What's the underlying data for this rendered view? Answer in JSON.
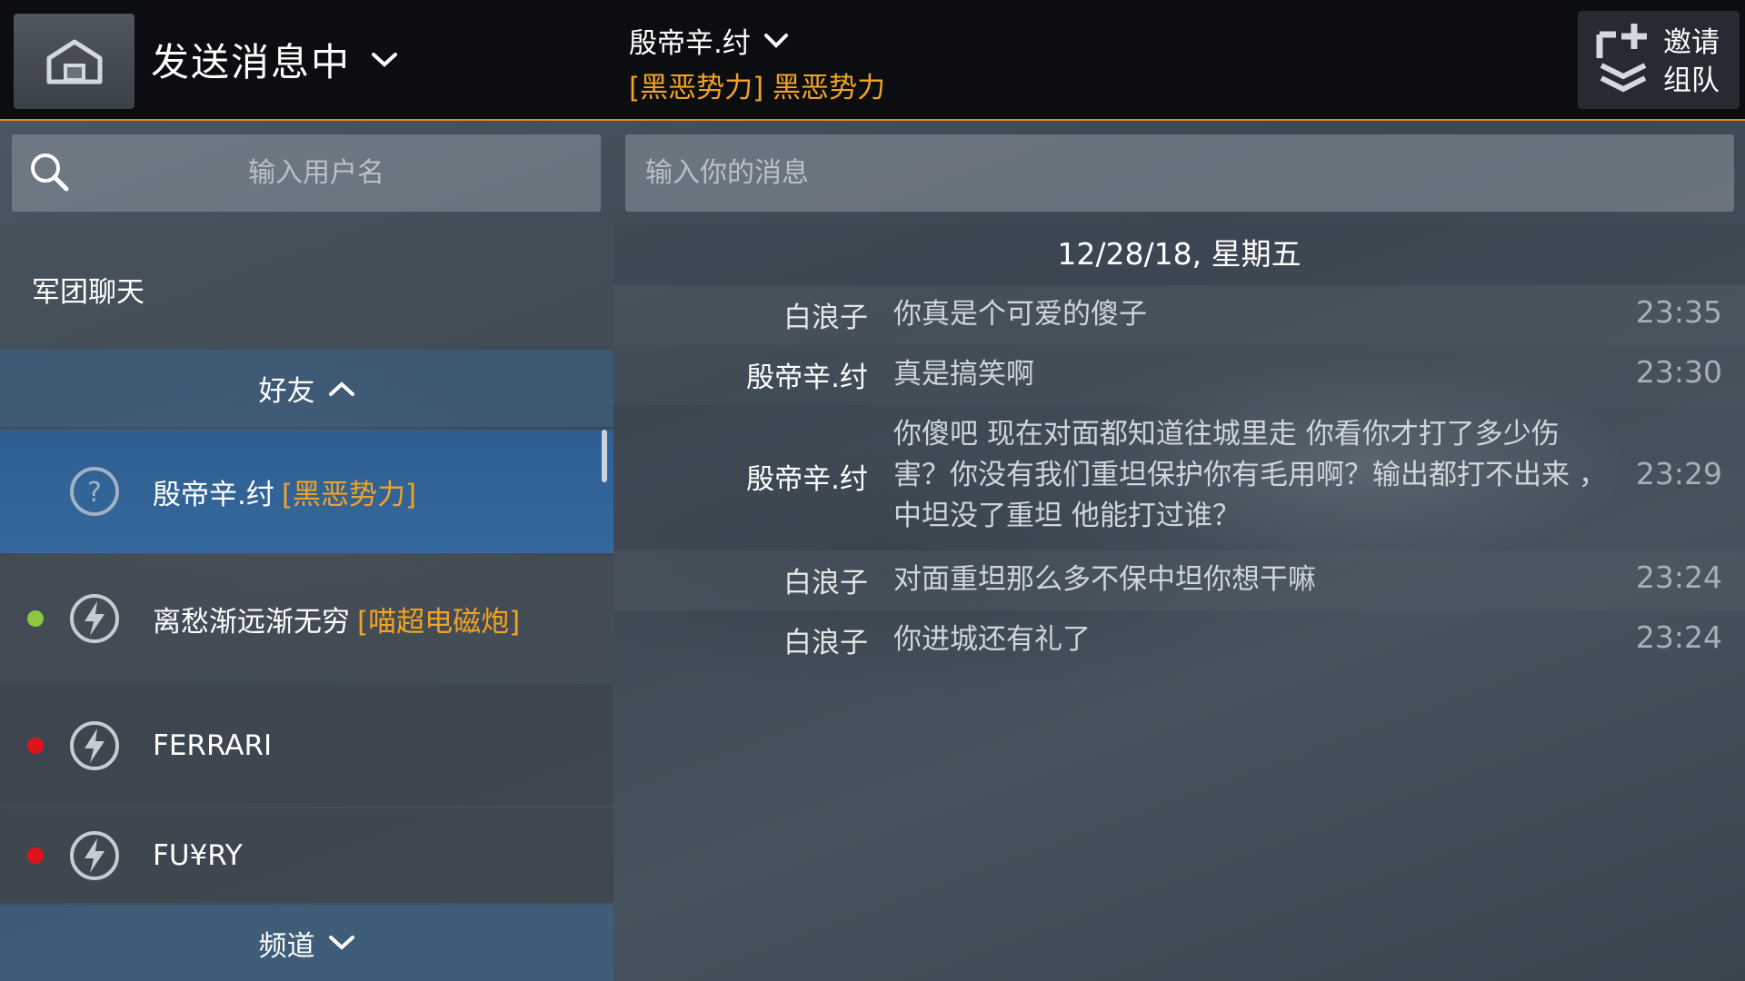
{
  "header": {
    "title": "发送消息中",
    "recipient_name": "殷帝辛.纣",
    "recipient_clan": "[黑恶势力] 黑恶势力",
    "invite_label_1": "邀请",
    "invite_label_2": "组队"
  },
  "search": {
    "user_placeholder": "输入用户名",
    "message_placeholder": "输入你的消息"
  },
  "sidebar": {
    "guild_chat": "军团聊天",
    "friends_header": "好友",
    "channels_header": "频道",
    "friends": [
      {
        "name": "殷帝辛.纣",
        "clan": "[黑恶势力]",
        "status": "unknown",
        "selected": true
      },
      {
        "name": "离愁渐远渐无穷",
        "clan": "[喵超电磁炮]",
        "status": "online",
        "status_color": "#8dc63f"
      },
      {
        "name": "FERRARI",
        "clan": "",
        "status": "offline",
        "status_color": "#e0131c"
      },
      {
        "name": "FU¥RY",
        "clan": "",
        "status": "offline",
        "status_color": "#e0131c"
      }
    ]
  },
  "chat": {
    "date": "12/28/18, 星期五",
    "messages": [
      {
        "sender": "白浪子",
        "text": "你真是个可爱的傻子",
        "time": "23:35"
      },
      {
        "sender": "殷帝辛.纣",
        "text": "真是搞笑啊",
        "time": "23:30"
      },
      {
        "sender": "殷帝辛.纣",
        "text": "你傻吧  现在对面都知道往城里走  你看你才打了多少伤害？你没有我们重坦保护你有毛用啊？输出都打不出来 ， 中坦没了重坦 他能打过谁？",
        "time": "23:29"
      },
      {
        "sender": "白浪子",
        "text": "对面重坦那么多不保中坦你想干嘛",
        "time": "23:24"
      },
      {
        "sender": "白浪子",
        "text": "你进城还有礼了",
        "time": "23:24"
      }
    ]
  },
  "colors": {
    "accent_orange": "#f2a322",
    "header_border": "#e08a1e",
    "selected_blue": "#35689c"
  },
  "icons": {
    "home": "home-icon",
    "search": "search-icon",
    "invite": "invite-squad-icon",
    "unknown_avatar": "question-icon",
    "friend_avatar": "lightning-icon"
  }
}
